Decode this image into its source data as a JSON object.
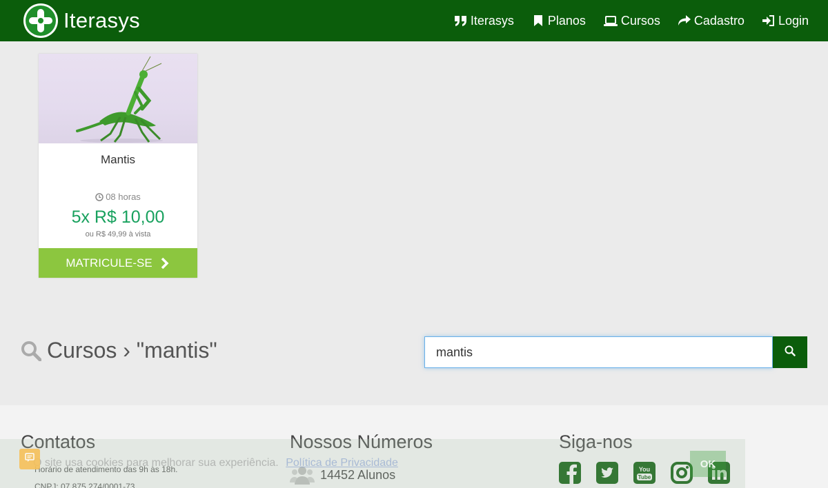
{
  "header": {
    "brand": "Iterasys",
    "nav": [
      {
        "label": "Iterasys",
        "icon": "quote-icon"
      },
      {
        "label": "Planos",
        "icon": "bookmark-icon"
      },
      {
        "label": "Cursos",
        "icon": "laptop-icon"
      },
      {
        "label": "Cadastro",
        "icon": "share-arrow-icon"
      },
      {
        "label": "Login",
        "icon": "sign-in-icon"
      }
    ]
  },
  "course": {
    "title": "Mantis",
    "hours": "08 horas",
    "price": "5x R$ 10,00",
    "cash_price": "ou R$ 49,99 à vista",
    "button_label": "MATRICULE-SE"
  },
  "search": {
    "heading": "Cursos › \"mantis\"",
    "value": "mantis"
  },
  "footer": {
    "contacts_title": "Contatos",
    "contacts_lines": [
      "Horário de atendimento das 9h às 18h.",
      "CNPJ: 07.875.274/0001-73"
    ],
    "numbers_title": "Nossos Números",
    "students": "14452 Alunos",
    "social_title": "Siga-nos",
    "social": [
      "facebook-icon",
      "twitter-icon",
      "youtube-icon",
      "instagram-icon",
      "linkedin-icon"
    ]
  },
  "cookie": {
    "text": "O site usa cookies para melhorar sua experiência.",
    "link": "Política de Privacidade",
    "ok": "OK"
  },
  "colors": {
    "navbar": "#0b5d0b",
    "price": "#18a15e",
    "enroll": "#8cc63f"
  }
}
